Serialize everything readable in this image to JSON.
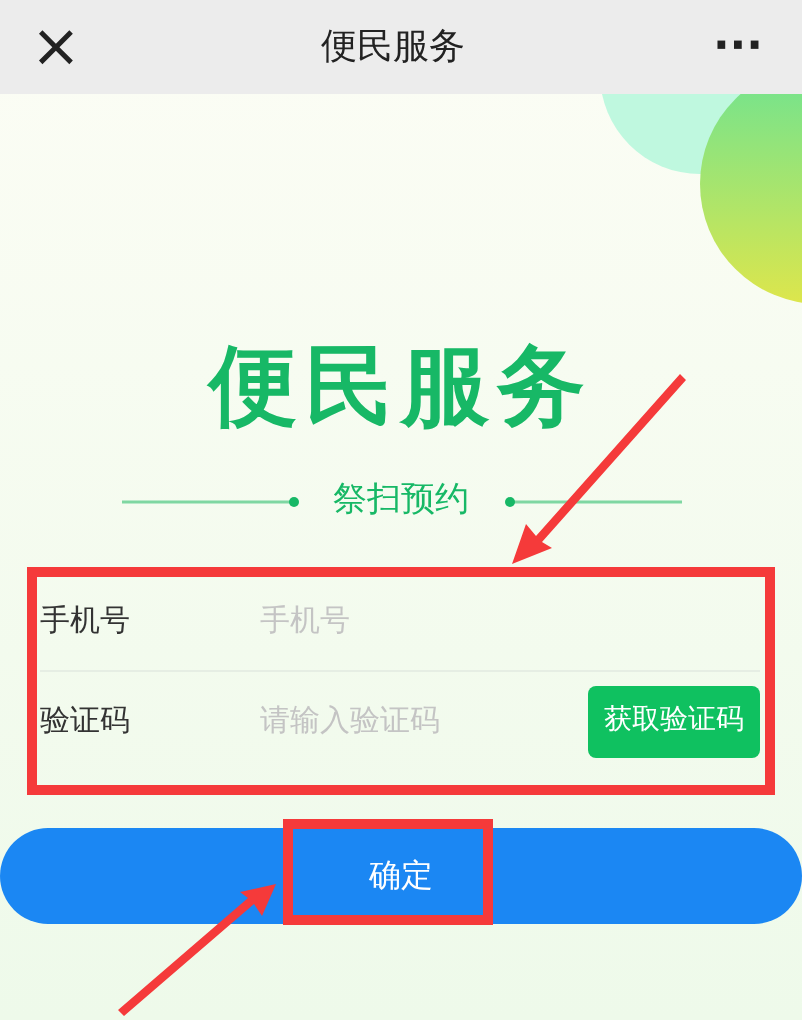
{
  "header": {
    "close": "×",
    "title": "便民服务",
    "more": "···"
  },
  "banner": {
    "title": "便民服务",
    "subtitle": "祭扫预约"
  },
  "form": {
    "fields": [
      {
        "label": "手机号",
        "placeholder": "手机号",
        "kind": "text"
      },
      {
        "label": "验证码",
        "placeholder": "请输入验证码",
        "kind": "code",
        "button": "获取验证码"
      }
    ]
  },
  "submit": "确定"
}
